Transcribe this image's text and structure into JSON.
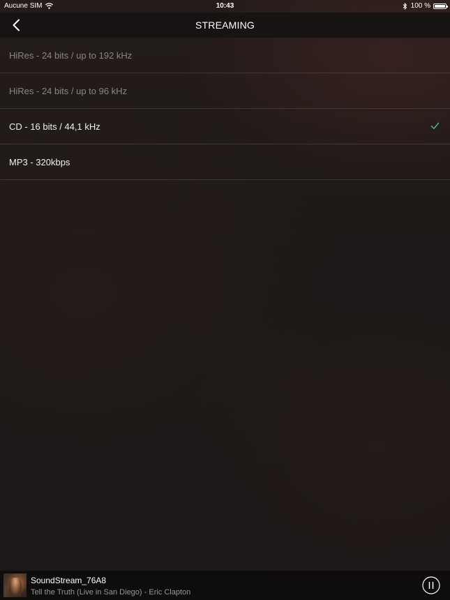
{
  "status_bar": {
    "carrier": "Aucune SIM",
    "time": "10:43",
    "battery": "100 %",
    "icons": [
      "wifi-icon",
      "bluetooth-icon",
      "battery-icon"
    ]
  },
  "nav": {
    "title": "STREAMING",
    "back_icon": "chevron-left-icon"
  },
  "quality_options": [
    {
      "label": "HiRes - 24 bits / up to 192 kHz",
      "enabled": false,
      "selected": false
    },
    {
      "label": "HiRes - 24 bits / up to 96 kHz",
      "enabled": false,
      "selected": false
    },
    {
      "label": "CD - 16 bits / 44,1 kHz",
      "enabled": true,
      "selected": true
    },
    {
      "label": "MP3 - 320kbps",
      "enabled": true,
      "selected": false
    }
  ],
  "player": {
    "device": "SoundStream_76A8",
    "track": "Tell the Truth (Live in San Diego) - Eric Clapton",
    "state_icon": "pause-icon"
  },
  "colors": {
    "accent_check": "#3fb58a",
    "background": "#1b1716",
    "nav_background": "#161312",
    "disabled_text": "#8a8583"
  }
}
